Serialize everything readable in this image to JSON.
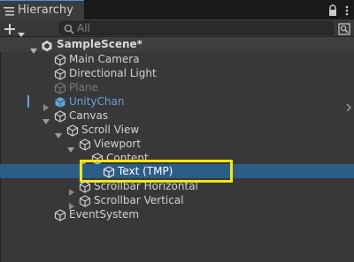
{
  "tab": {
    "title": "Hierarchy"
  },
  "toolbar": {
    "search_placeholder": "All"
  },
  "scene": {
    "name": "SampleScene*"
  },
  "tree": [
    {
      "label": "Main Camera"
    },
    {
      "label": "Directional Light"
    },
    {
      "label": "Plane"
    },
    {
      "label": "UnityChan"
    },
    {
      "label": "Canvas"
    },
    {
      "label": "Scroll View"
    },
    {
      "label": "Viewport"
    },
    {
      "label": "Content"
    },
    {
      "label": "Text (TMP)"
    },
    {
      "label": "Scrollbar Horizontal"
    },
    {
      "label": "Scrollbar Vertical"
    },
    {
      "label": "EventSystem"
    }
  ],
  "colors": {
    "selection": "#2c5d87",
    "highlight_box": "#f2e617",
    "prefab_blue": "#6aa1dc",
    "disabled_text": "#7a7a7a"
  },
  "icons": [
    "hierarchy-icon",
    "lock-icon",
    "more-icon",
    "plus-icon",
    "dropdown-icon",
    "search-icon",
    "search-options-icon",
    "unity-logo-icon",
    "gameobject-icon",
    "prefab-icon",
    "chevron-right-icon"
  ]
}
